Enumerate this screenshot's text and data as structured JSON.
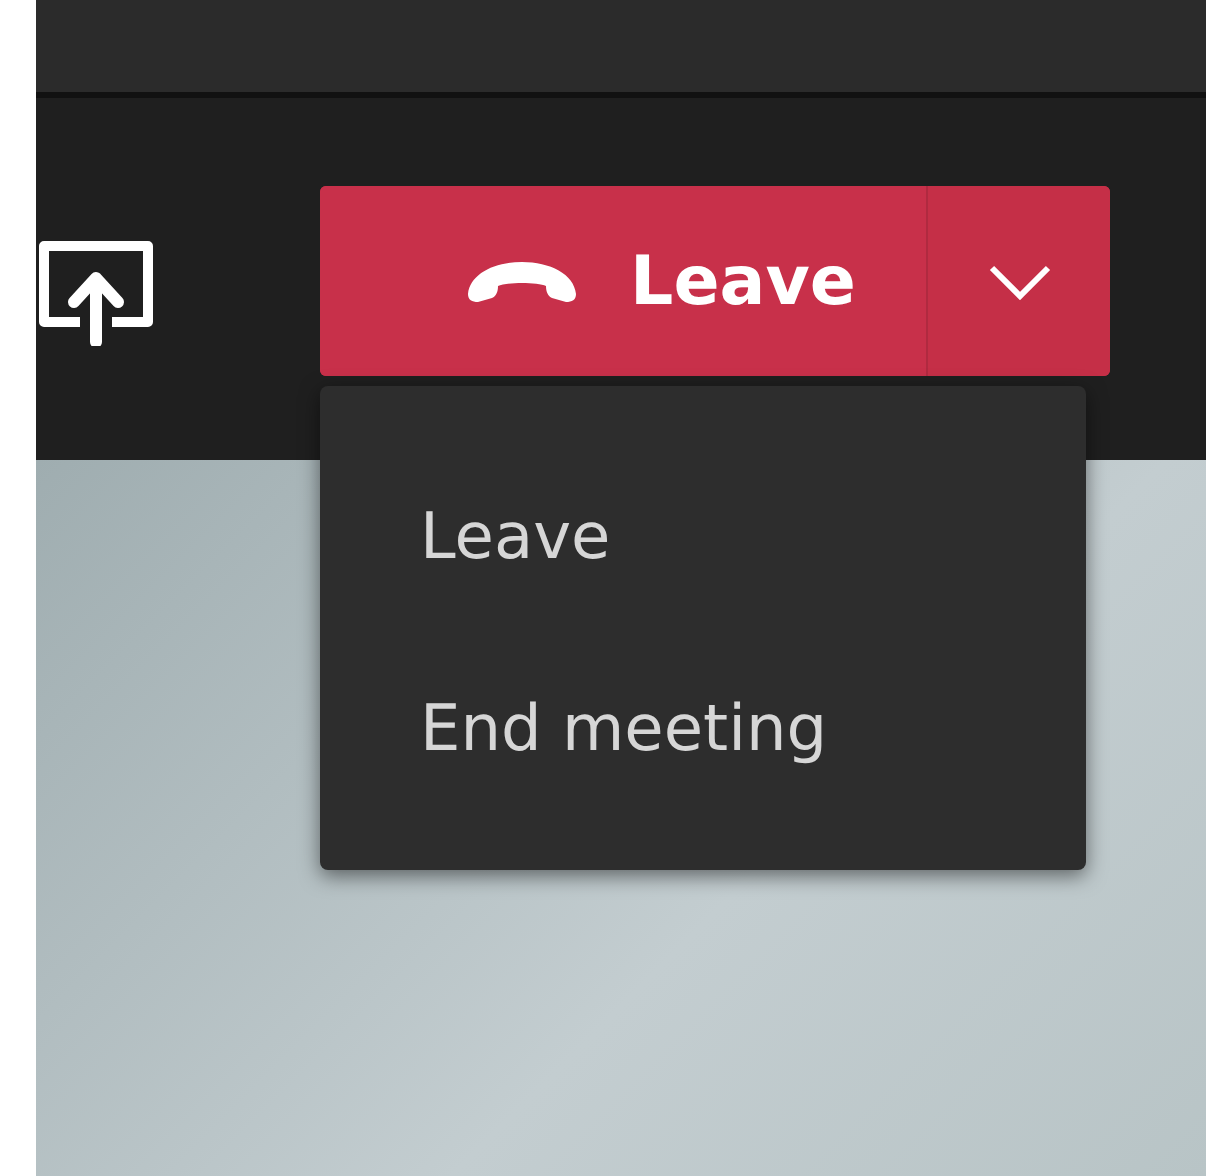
{
  "leave_button": {
    "label": "Leave"
  },
  "leave_menu": {
    "items": [
      {
        "label": "Leave"
      },
      {
        "label": "End meeting"
      }
    ]
  }
}
